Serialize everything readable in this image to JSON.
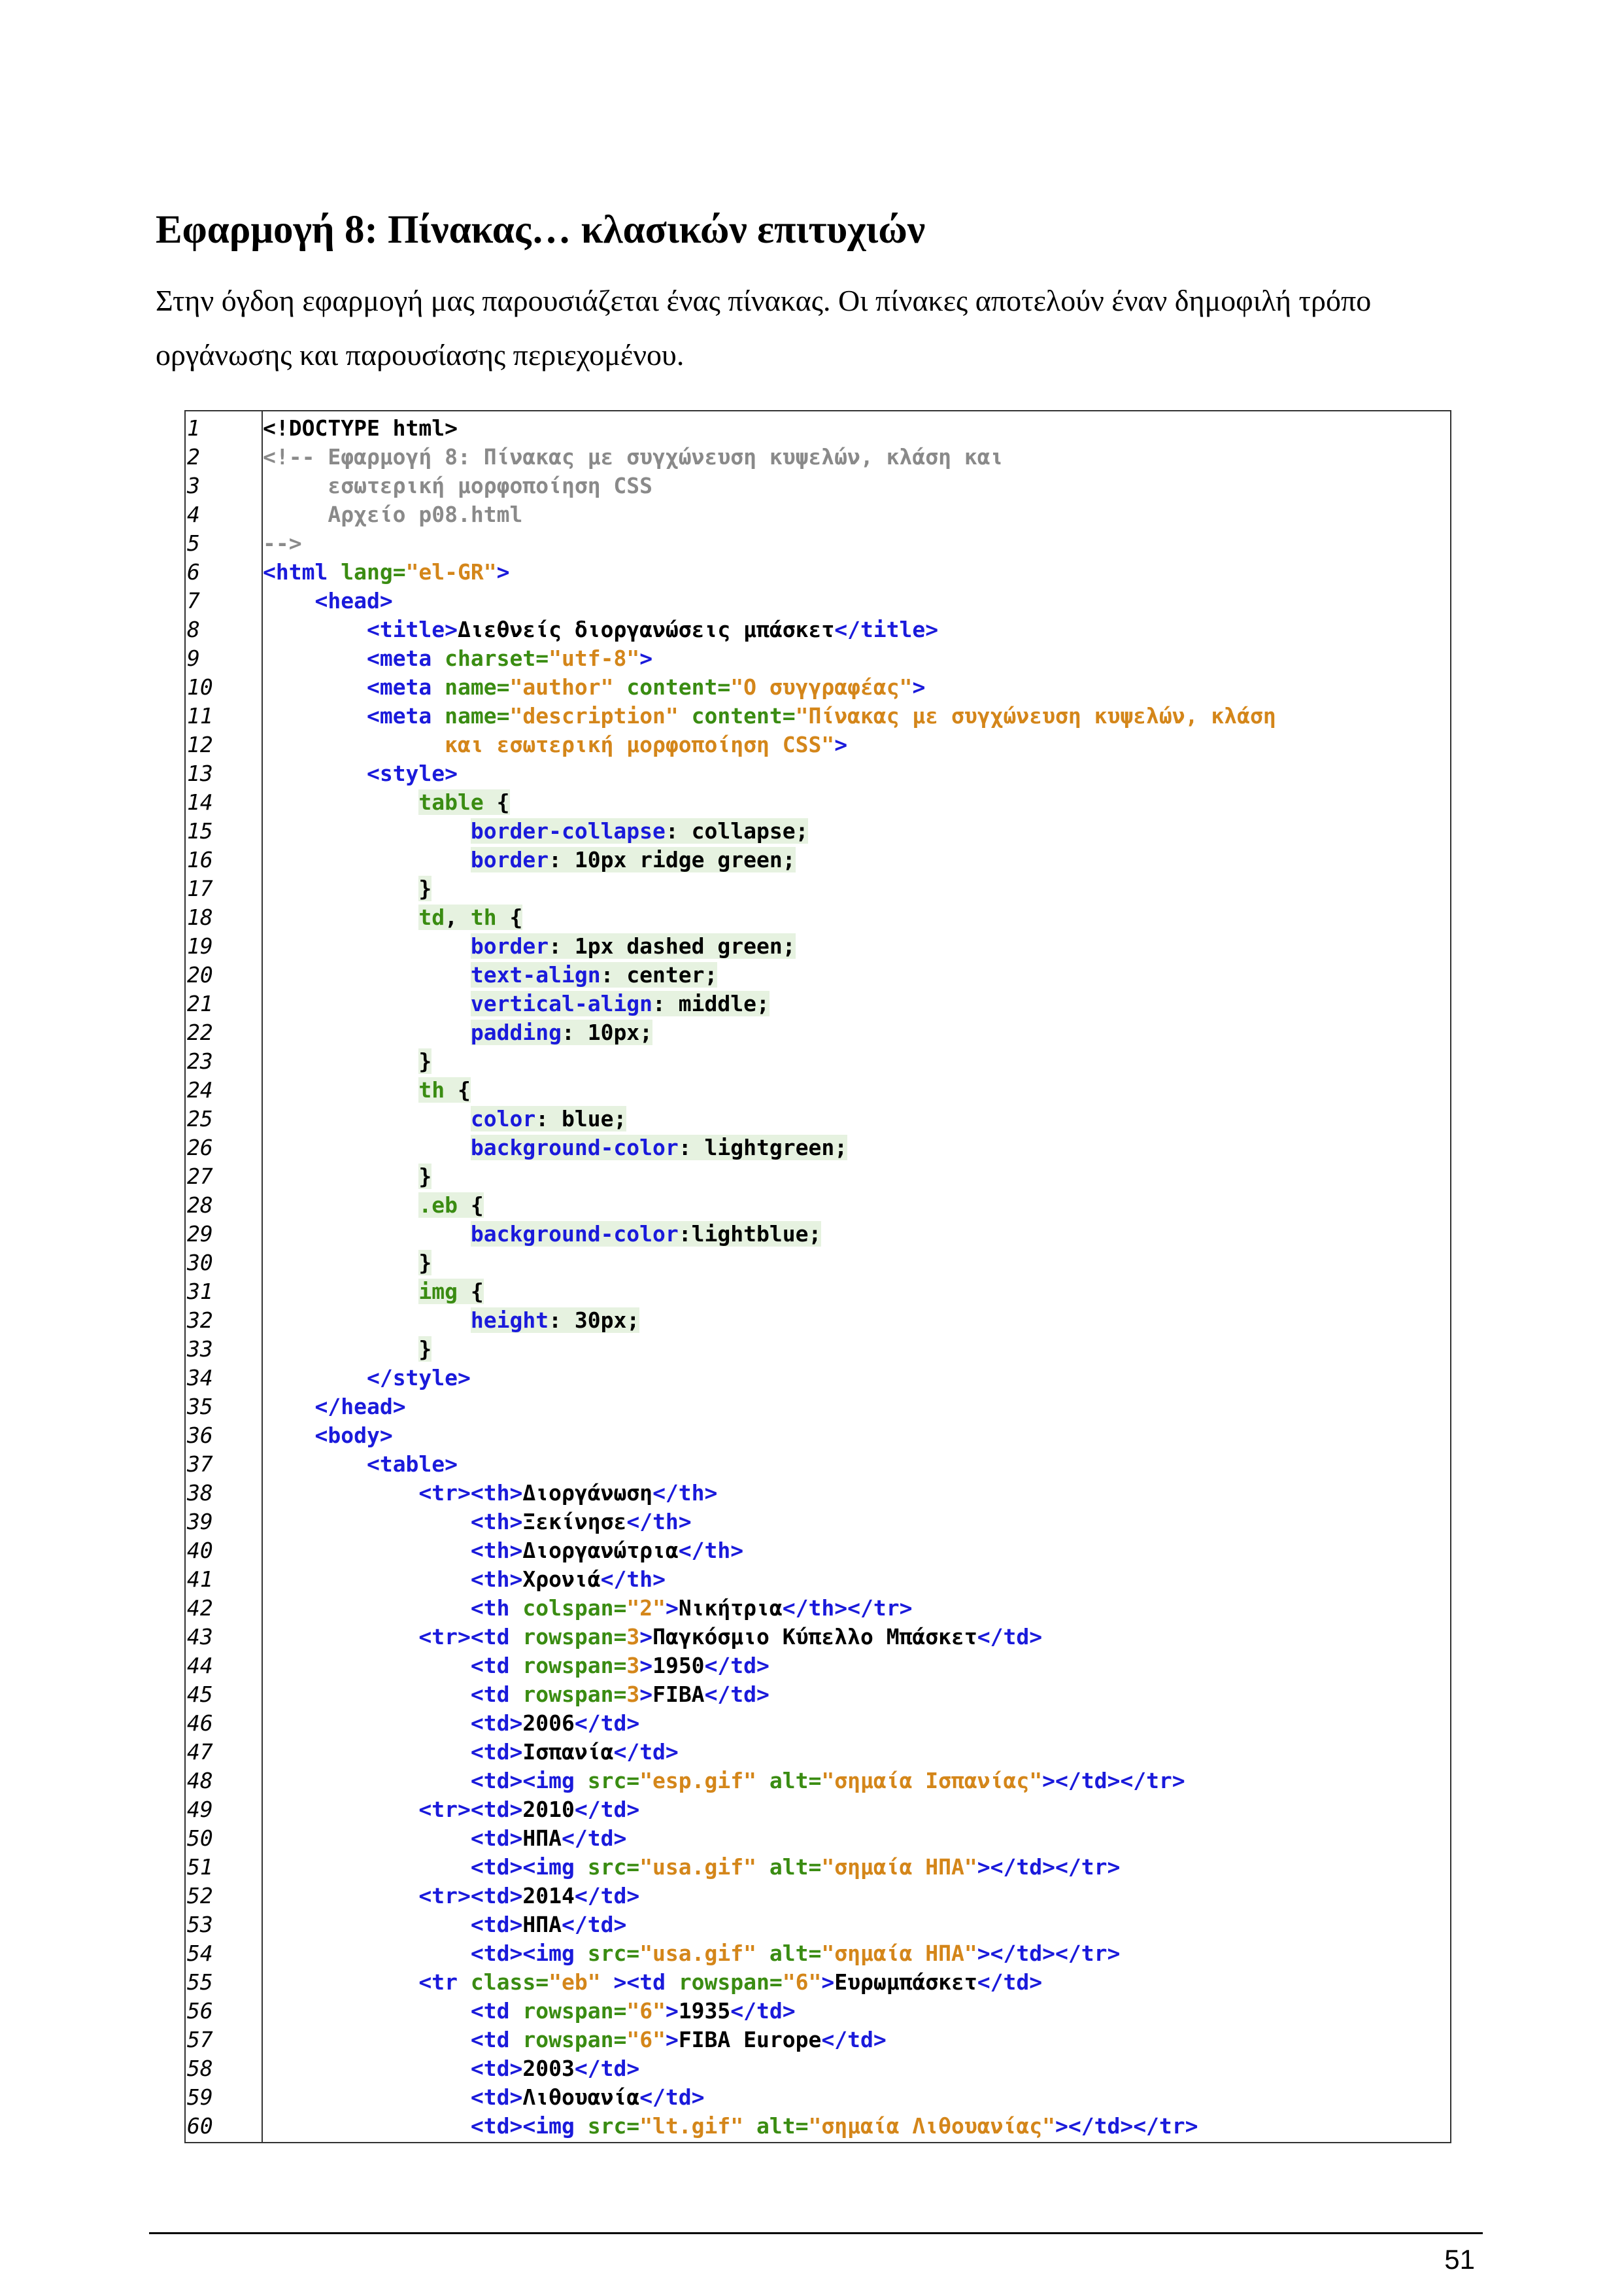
{
  "heading": "Εφαρμογή 8: Πίνακας… κλασικών επιτυχιών",
  "intro": "Στην όγδοη εφαρμογή μας παρουσιάζεται ένας πίνακας. Οι πίνακες αποτελούν έναν δημοφιλή τρόπο οργάνωσης και παρουσίασης περιεχομένου.",
  "page_number": "51",
  "code_lines": [
    [
      [
        "k",
        "<!DOCTYPE html>"
      ]
    ],
    [
      [
        "c",
        "<!-- Εφαρμογή 8: Πίνακας με συγχώνευση κυψελών, κλάση και"
      ]
    ],
    [
      [
        "c",
        "     εσωτερική μορφοποίηση CSS"
      ]
    ],
    [
      [
        "c",
        "     Αρχείο p08.html"
      ]
    ],
    [
      [
        "c",
        "-->"
      ]
    ],
    [
      [
        "t",
        "<html "
      ],
      [
        "a",
        "lang="
      ],
      [
        "v",
        "\"el-GR\""
      ],
      [
        "t",
        ">"
      ]
    ],
    [
      [
        "k",
        "    "
      ],
      [
        "t",
        "<head>"
      ]
    ],
    [
      [
        "k",
        "        "
      ],
      [
        "t",
        "<title>"
      ],
      [
        "k",
        "Διεθνείς διοργανώσεις μπάσκετ"
      ],
      [
        "t",
        "</title>"
      ]
    ],
    [
      [
        "k",
        "        "
      ],
      [
        "t",
        "<meta "
      ],
      [
        "a",
        "charset="
      ],
      [
        "v",
        "\"utf-8\""
      ],
      [
        "t",
        ">"
      ]
    ],
    [
      [
        "k",
        "        "
      ],
      [
        "t",
        "<meta "
      ],
      [
        "a",
        "name="
      ],
      [
        "v",
        "\"author\" "
      ],
      [
        "a",
        "content="
      ],
      [
        "v",
        "\"Ο συγγραφέας\""
      ],
      [
        "t",
        ">"
      ]
    ],
    [
      [
        "k",
        "        "
      ],
      [
        "t",
        "<meta "
      ],
      [
        "a",
        "name="
      ],
      [
        "v",
        "\"description\" "
      ],
      [
        "a",
        "content="
      ],
      [
        "v",
        "\"Πίνακας με συγχώνευση κυψελών, κλάση"
      ]
    ],
    [
      [
        "v",
        "              και εσωτερική μορφοποίηση CSS\""
      ],
      [
        "t",
        ">"
      ]
    ],
    [
      [
        "k",
        "        "
      ],
      [
        "t",
        "<style>"
      ]
    ],
    [
      [
        "k",
        "            "
      ],
      [
        "ah",
        "table"
      ],
      [
        "kh",
        " {"
      ]
    ],
    [
      [
        "k",
        "                "
      ],
      [
        "th",
        "border-collapse"
      ],
      [
        "kh",
        ": collapse;"
      ]
    ],
    [
      [
        "k",
        "                "
      ],
      [
        "th",
        "border"
      ],
      [
        "kh",
        ": 10px ridge green;"
      ]
    ],
    [
      [
        "k",
        "            "
      ],
      [
        "kh",
        "}"
      ]
    ],
    [
      [
        "k",
        "            "
      ],
      [
        "ah",
        "td"
      ],
      [
        "kh",
        ", "
      ],
      [
        "ah",
        "th"
      ],
      [
        "kh",
        " {"
      ]
    ],
    [
      [
        "k",
        "                "
      ],
      [
        "th",
        "border"
      ],
      [
        "kh",
        ": 1px dashed green;"
      ]
    ],
    [
      [
        "k",
        "                "
      ],
      [
        "th",
        "text-align"
      ],
      [
        "kh",
        ": center;"
      ]
    ],
    [
      [
        "k",
        "                "
      ],
      [
        "th",
        "vertical-align"
      ],
      [
        "kh",
        ": middle;"
      ]
    ],
    [
      [
        "k",
        "                "
      ],
      [
        "th",
        "padding"
      ],
      [
        "kh",
        ": 10px;"
      ]
    ],
    [
      [
        "k",
        "            "
      ],
      [
        "kh",
        "}"
      ]
    ],
    [
      [
        "k",
        "            "
      ],
      [
        "ah",
        "th"
      ],
      [
        "kh",
        " {"
      ]
    ],
    [
      [
        "k",
        "                "
      ],
      [
        "th",
        "color"
      ],
      [
        "kh",
        ": blue;"
      ]
    ],
    [
      [
        "k",
        "                "
      ],
      [
        "th",
        "background-color"
      ],
      [
        "kh",
        ": lightgreen;"
      ]
    ],
    [
      [
        "k",
        "            "
      ],
      [
        "kh",
        "}"
      ]
    ],
    [
      [
        "k",
        "            "
      ],
      [
        "ah",
        ".eb"
      ],
      [
        "kh",
        " {"
      ]
    ],
    [
      [
        "k",
        "                "
      ],
      [
        "th",
        "background-color"
      ],
      [
        "kh",
        ":lightblue;"
      ]
    ],
    [
      [
        "k",
        "            "
      ],
      [
        "kh",
        "}"
      ]
    ],
    [
      [
        "k",
        "            "
      ],
      [
        "ah",
        "img"
      ],
      [
        "kh",
        " {"
      ]
    ],
    [
      [
        "k",
        "                "
      ],
      [
        "th",
        "height"
      ],
      [
        "kh",
        ": 30px;"
      ]
    ],
    [
      [
        "k",
        "            "
      ],
      [
        "kh",
        "}"
      ]
    ],
    [
      [
        "k",
        "        "
      ],
      [
        "t",
        "</style>"
      ]
    ],
    [
      [
        "k",
        "    "
      ],
      [
        "t",
        "</head>"
      ]
    ],
    [
      [
        "k",
        "    "
      ],
      [
        "t",
        "<body>"
      ]
    ],
    [
      [
        "k",
        "        "
      ],
      [
        "t",
        "<table>"
      ]
    ],
    [
      [
        "k",
        "            "
      ],
      [
        "t",
        "<tr><th>"
      ],
      [
        "k",
        "Διοργάνωση"
      ],
      [
        "t",
        "</th>"
      ]
    ],
    [
      [
        "k",
        "                "
      ],
      [
        "t",
        "<th>"
      ],
      [
        "k",
        "Ξεκίνησε"
      ],
      [
        "t",
        "</th>"
      ]
    ],
    [
      [
        "k",
        "                "
      ],
      [
        "t",
        "<th>"
      ],
      [
        "k",
        "Διοργανώτρια"
      ],
      [
        "t",
        "</th>"
      ]
    ],
    [
      [
        "k",
        "                "
      ],
      [
        "t",
        "<th>"
      ],
      [
        "k",
        "Χρονιά"
      ],
      [
        "t",
        "</th>"
      ]
    ],
    [
      [
        "k",
        "                "
      ],
      [
        "t",
        "<th "
      ],
      [
        "a",
        "colspan="
      ],
      [
        "v",
        "\"2\""
      ],
      [
        "t",
        ">"
      ],
      [
        "k",
        "Νικήτρια"
      ],
      [
        "t",
        "</th></tr>"
      ]
    ],
    [
      [
        "k",
        "            "
      ],
      [
        "t",
        "<tr><td "
      ],
      [
        "a",
        "rowspan="
      ],
      [
        "v",
        "3"
      ],
      [
        "t",
        ">"
      ],
      [
        "k",
        "Παγκόσμιο Κύπελλο Μπάσκετ"
      ],
      [
        "t",
        "</td>"
      ]
    ],
    [
      [
        "k",
        "                "
      ],
      [
        "t",
        "<td "
      ],
      [
        "a",
        "rowspan="
      ],
      [
        "v",
        "3"
      ],
      [
        "t",
        ">"
      ],
      [
        "k",
        "1950"
      ],
      [
        "t",
        "</td>"
      ]
    ],
    [
      [
        "k",
        "                "
      ],
      [
        "t",
        "<td "
      ],
      [
        "a",
        "rowspan="
      ],
      [
        "v",
        "3"
      ],
      [
        "t",
        ">"
      ],
      [
        "k",
        "FIBA"
      ],
      [
        "t",
        "</td>"
      ]
    ],
    [
      [
        "k",
        "                "
      ],
      [
        "t",
        "<td>"
      ],
      [
        "k",
        "2006"
      ],
      [
        "t",
        "</td>"
      ]
    ],
    [
      [
        "k",
        "                "
      ],
      [
        "t",
        "<td>"
      ],
      [
        "k",
        "Ισπανία"
      ],
      [
        "t",
        "</td>"
      ]
    ],
    [
      [
        "k",
        "                "
      ],
      [
        "t",
        "<td><img "
      ],
      [
        "a",
        "src="
      ],
      [
        "v",
        "\"esp.gif\" "
      ],
      [
        "a",
        "alt="
      ],
      [
        "v",
        "\"σημαία Ισπανίας\""
      ],
      [
        "t",
        "></td></tr>"
      ]
    ],
    [
      [
        "k",
        "            "
      ],
      [
        "t",
        "<tr><td>"
      ],
      [
        "k",
        "2010"
      ],
      [
        "t",
        "</td>"
      ]
    ],
    [
      [
        "k",
        "                "
      ],
      [
        "t",
        "<td>"
      ],
      [
        "k",
        "ΗΠΑ"
      ],
      [
        "t",
        "</td>"
      ]
    ],
    [
      [
        "k",
        "                "
      ],
      [
        "t",
        "<td><img "
      ],
      [
        "a",
        "src="
      ],
      [
        "v",
        "\"usa.gif\" "
      ],
      [
        "a",
        "alt="
      ],
      [
        "v",
        "\"σημαία ΗΠΑ\""
      ],
      [
        "t",
        "></td></tr>"
      ]
    ],
    [
      [
        "k",
        "            "
      ],
      [
        "t",
        "<tr><td>"
      ],
      [
        "k",
        "2014"
      ],
      [
        "t",
        "</td>"
      ]
    ],
    [
      [
        "k",
        "                "
      ],
      [
        "t",
        "<td>"
      ],
      [
        "k",
        "ΗΠΑ"
      ],
      [
        "t",
        "</td>"
      ]
    ],
    [
      [
        "k",
        "                "
      ],
      [
        "t",
        "<td><img "
      ],
      [
        "a",
        "src="
      ],
      [
        "v",
        "\"usa.gif\" "
      ],
      [
        "a",
        "alt="
      ],
      [
        "v",
        "\"σημαία ΗΠΑ\""
      ],
      [
        "t",
        "></td></tr>"
      ]
    ],
    [
      [
        "k",
        "            "
      ],
      [
        "t",
        "<tr "
      ],
      [
        "a",
        "class="
      ],
      [
        "v",
        "\"eb\" "
      ],
      [
        "t",
        "><td "
      ],
      [
        "a",
        "rowspan="
      ],
      [
        "v",
        "\"6\""
      ],
      [
        "t",
        ">"
      ],
      [
        "k",
        "Ευρωμπάσκετ"
      ],
      [
        "t",
        "</td>"
      ]
    ],
    [
      [
        "k",
        "                "
      ],
      [
        "t",
        "<td "
      ],
      [
        "a",
        "rowspan="
      ],
      [
        "v",
        "\"6\""
      ],
      [
        "t",
        ">"
      ],
      [
        "k",
        "1935"
      ],
      [
        "t",
        "</td>"
      ]
    ],
    [
      [
        "k",
        "                "
      ],
      [
        "t",
        "<td "
      ],
      [
        "a",
        "rowspan="
      ],
      [
        "v",
        "\"6\""
      ],
      [
        "t",
        ">"
      ],
      [
        "k",
        "FIBA Europe"
      ],
      [
        "t",
        "</td>"
      ]
    ],
    [
      [
        "k",
        "                "
      ],
      [
        "t",
        "<td>"
      ],
      [
        "k",
        "2003"
      ],
      [
        "t",
        "</td>"
      ]
    ],
    [
      [
        "k",
        "                "
      ],
      [
        "t",
        "<td>"
      ],
      [
        "k",
        "Λιθουανία"
      ],
      [
        "t",
        "</td>"
      ]
    ],
    [
      [
        "k",
        "                "
      ],
      [
        "t",
        "<td><img "
      ],
      [
        "a",
        "src="
      ],
      [
        "v",
        "\"lt.gif\" "
      ],
      [
        "a",
        "alt="
      ],
      [
        "v",
        "\"σημαία Λιθουανίας\""
      ],
      [
        "t",
        "></td></tr>"
      ]
    ]
  ]
}
